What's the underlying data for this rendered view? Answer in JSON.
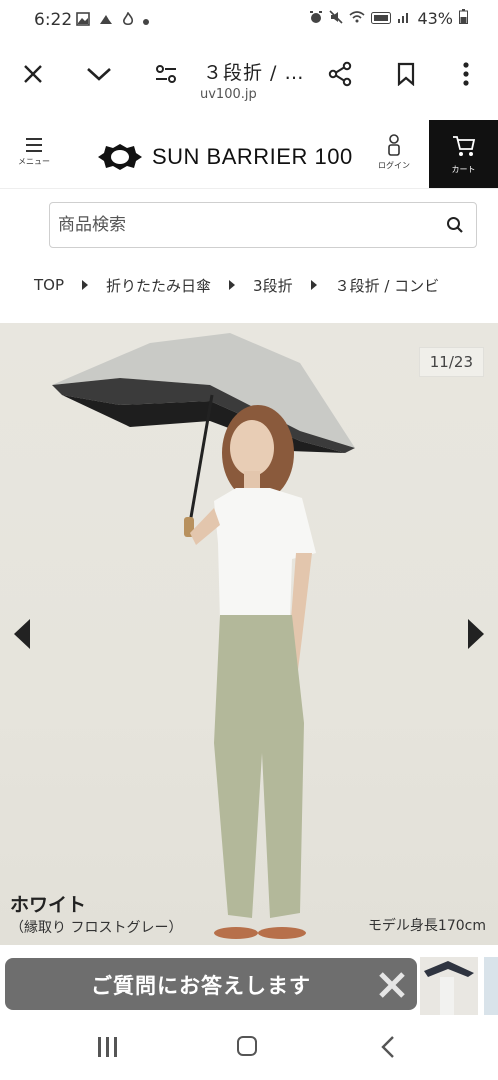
{
  "status_bar": {
    "time": "6:22",
    "battery": "43%",
    "icons": [
      "image-icon",
      "cloud-icon",
      "fire-icon",
      "dot-icon",
      "alarm-icon",
      "mute-icon",
      "wifi-icon",
      "volte-icon",
      "signal-icon",
      "battery-icon"
    ]
  },
  "browser": {
    "title": "３段折 / …",
    "url": "uv100.jp",
    "icons": [
      "close-icon",
      "chevron-down-icon",
      "tune-icon",
      "share-icon",
      "bookmark-icon",
      "more-icon"
    ]
  },
  "header": {
    "menu_label": "メニュー",
    "logo_text": "SUN BARRIER 100",
    "login_label": "ログイン",
    "cart_label": "カート"
  },
  "search": {
    "placeholder": "商品検索"
  },
  "breadcrumb": {
    "items": [
      "TOP",
      "折りたたみ日傘",
      "3段折",
      "３段折 / コンビ"
    ]
  },
  "gallery": {
    "counter": "11/23",
    "color_name": "ホワイト",
    "color_sub": "（縁取り フロストグレー）",
    "model_height": "モデル身長170cm"
  },
  "banner": {
    "text": "ご質問にお答えします"
  },
  "colors": {
    "cart_bg": "#111111",
    "banner_bg": "#5a5a5a",
    "photo_bg": "#e8e6df",
    "pants": "#b3b89a"
  }
}
